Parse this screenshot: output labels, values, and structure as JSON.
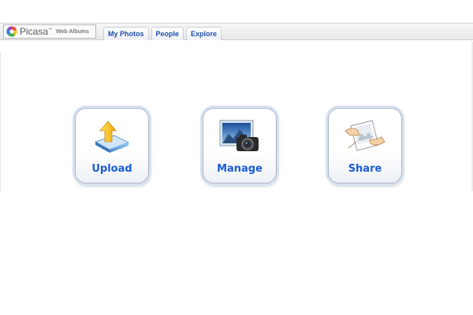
{
  "app": {
    "logo_word": "Picasa",
    "logo_tm": "™",
    "logo_sub": "Web Albums"
  },
  "tabs": [
    "My Photos",
    "People",
    "Explore"
  ],
  "tiles": [
    {
      "label": "Upload",
      "icon": "upload-icon"
    },
    {
      "label": "Manage",
      "icon": "camera-photo-icon"
    },
    {
      "label": "Share",
      "icon": "share-photo-icon"
    }
  ],
  "colors": {
    "accent": "#1a5dd6",
    "tab_text": "#1f4fa8",
    "tile_border": "#a9b4c7"
  }
}
